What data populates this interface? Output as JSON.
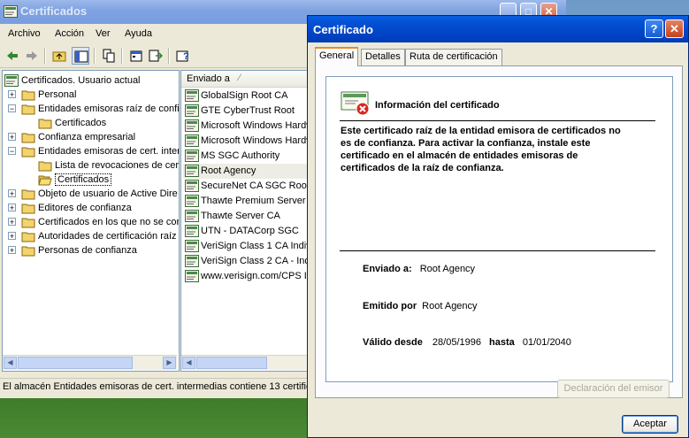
{
  "main_window": {
    "title": "Certificados",
    "menu": [
      "Archivo",
      "Acción",
      "Ver",
      "Ayuda"
    ],
    "tree": [
      {
        "label": "Certificados. Usuario actual",
        "level": 0,
        "expander": "",
        "icon": "cert-store-icon"
      },
      {
        "label": "Personal",
        "level": 1,
        "expander": "+",
        "icon": "folder-icon"
      },
      {
        "label": "Entidades emisoras raíz de confia",
        "level": 1,
        "expander": "-",
        "icon": "folder-icon"
      },
      {
        "label": "Certificados",
        "level": 2,
        "expander": "",
        "icon": "folder-icon"
      },
      {
        "label": "Confianza empresarial",
        "level": 1,
        "expander": "+",
        "icon": "folder-icon"
      },
      {
        "label": "Entidades emisoras de cert. inter",
        "level": 1,
        "expander": "-",
        "icon": "folder-icon"
      },
      {
        "label": "Lista de revocaciones de cert",
        "level": 2,
        "expander": "",
        "icon": "folder-icon"
      },
      {
        "label": "Certificados",
        "level": 2,
        "expander": "",
        "icon": "folder-open-icon",
        "selected": true
      },
      {
        "label": "Objeto de usuario de Active Dire",
        "level": 1,
        "expander": "+",
        "icon": "folder-icon"
      },
      {
        "label": "Editores de confianza",
        "level": 1,
        "expander": "+",
        "icon": "folder-icon"
      },
      {
        "label": "Certificados en los que no se con",
        "level": 1,
        "expander": "+",
        "icon": "folder-icon"
      },
      {
        "label": "Autoridades de certificación raíz",
        "level": 1,
        "expander": "+",
        "icon": "folder-icon"
      },
      {
        "label": "Personas de confianza",
        "level": 1,
        "expander": "+",
        "icon": "folder-icon"
      }
    ],
    "list_header": "Enviado a",
    "list": [
      "GlobalSign Root CA",
      "GTE CyberTrust Root",
      "Microsoft Windows Hardw",
      "Microsoft Windows Hardw",
      "MS SGC Authority",
      "Root Agency",
      "SecureNet CA SGC Root",
      "Thawte Premium Server C",
      "Thawte Server CA",
      "UTN - DATACorp SGC",
      "VeriSign Class 1 CA Indivi",
      "VeriSign Class 2 CA - Indiv",
      "www.verisign.com/CPS In"
    ],
    "selected_list_index": 5,
    "status": "El almacén Entidades emisoras de cert. intermedias contiene 13 certifica"
  },
  "dialog": {
    "title": "Certificado",
    "help_glyph": "?",
    "close_glyph": "✕",
    "tabs": [
      "General",
      "Detalles",
      "Ruta de certificación"
    ],
    "heading": "Información del certificado",
    "warning": "Este certificado raíz de la entidad emisora de certificados no es de confianza. Para activar la confianza, instale este certificado en el almacén de entidades emisoras de certificados de la raíz de confianza.",
    "issued_to_label": "Enviado a:",
    "issued_to": "Root Agency",
    "issued_by_label": "Emitido por",
    "issued_by": "Root Agency",
    "valid_from_label": "Válido desde",
    "valid_from": "28/05/1996",
    "valid_to_label": "hasta",
    "valid_to": "01/01/2040",
    "issuer_statement_button": "Declaración del emisor",
    "ok_button": "Aceptar"
  },
  "colors": {
    "dialog_title": "#0042c2",
    "face": "#ece9d8",
    "tab_highlight": "#e68b2c",
    "error_red": "#d8261d"
  }
}
